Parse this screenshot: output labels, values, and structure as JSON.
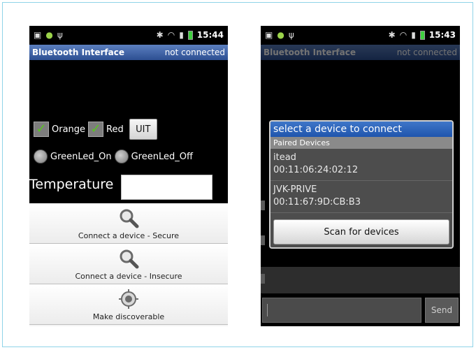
{
  "left_screen": {
    "statusbar": {
      "time": "15:44"
    },
    "titlebar": {
      "title": "Bluetooth Interface",
      "status": "not connected"
    },
    "checkboxes": [
      {
        "label": "Orange",
        "checked": true
      },
      {
        "label": "Red",
        "checked": true
      }
    ],
    "uit_button": "UIT",
    "radios": [
      {
        "label": "GreenLed_On"
      },
      {
        "label": "GreenLed_Off"
      }
    ],
    "temperature_label": "Temperature",
    "menu": [
      {
        "label": "Connect a device - Secure",
        "icon": "magnifier-icon"
      },
      {
        "label": "Connect a device - Insecure",
        "icon": "magnifier-icon"
      },
      {
        "label": "Make discoverable",
        "icon": "target-icon"
      }
    ]
  },
  "right_screen": {
    "statusbar": {
      "time": "15:43"
    },
    "titlebar": {
      "title": "Bluetooth Interface",
      "status": "not connected"
    },
    "dialog": {
      "title": "select a device to connect",
      "section": "Paired Devices",
      "devices": [
        {
          "name": "itead",
          "address": "00:11:06:24:02:12"
        },
        {
          "name": "JVK-PRIVE",
          "address": "00:11:67:9D:CB:B3"
        }
      ],
      "scan_button": "Scan for devices"
    },
    "send_button": "Send"
  },
  "colors": {
    "titlebar": "#3a5ea6",
    "dialog_title": "#2a63bb",
    "check": "#58c81e",
    "frame_border": "#8fd3e8"
  }
}
